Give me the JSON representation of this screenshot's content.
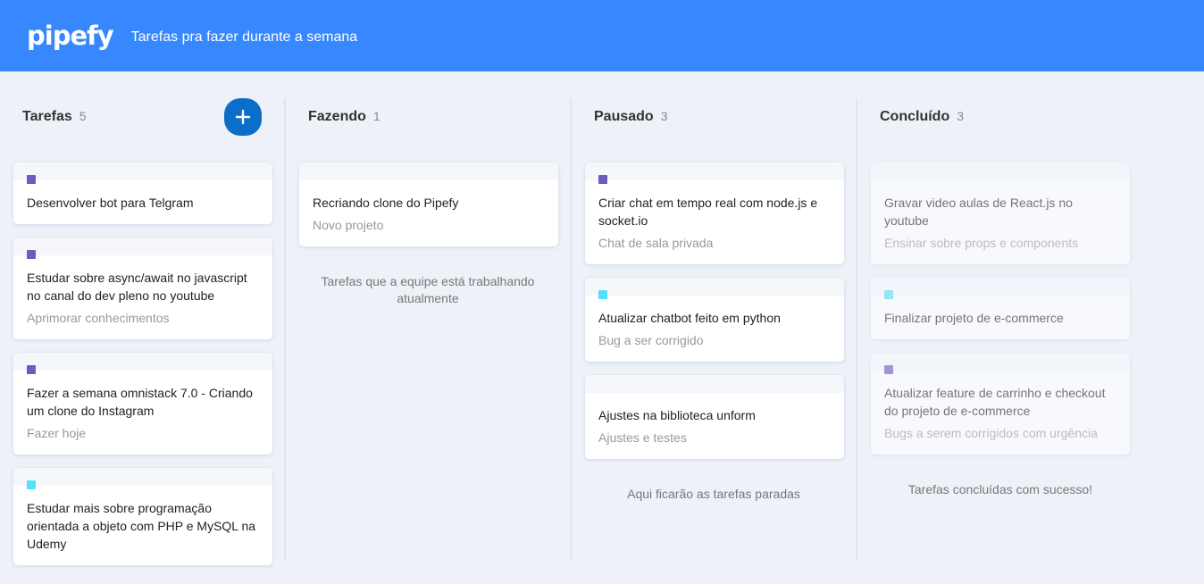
{
  "header": {
    "logo": "pipefy",
    "subtitle": "Tarefas pra fazer durante a semana"
  },
  "colors": {
    "header_bg": "#3788ff",
    "add_button": "#0b6fca",
    "label_purple": "#7159c1",
    "label_cyan": "#54e1f7"
  },
  "lists": [
    {
      "title": "Tarefas",
      "count": "5",
      "creatable": true,
      "cards": [
        {
          "title": "Desenvolver bot para Telgram",
          "subtitle": "",
          "label": "#7159c1"
        },
        {
          "title": "Estudar sobre async/await no javascript no canal do dev pleno no youtube",
          "subtitle": "Aprimorar conhecimentos",
          "label": "#7159c1"
        },
        {
          "title": "Fazer a semana omnistack 7.0 - Criando um clone do Instagram",
          "subtitle": "Fazer hoje",
          "label": "#7159c1"
        },
        {
          "title": "Estudar mais sobre programação orientada a objeto com PHP e MySQL na Udemy",
          "subtitle": "",
          "label": "#54e1f7"
        }
      ],
      "note": ""
    },
    {
      "title": "Fazendo",
      "count": "1",
      "creatable": false,
      "cards": [
        {
          "title": "Recriando clone do Pipefy",
          "subtitle": "Novo projeto",
          "label": ""
        }
      ],
      "note": "Tarefas que a equipe está trabalhando atualmente"
    },
    {
      "title": "Pausado",
      "count": "3",
      "creatable": false,
      "cards": [
        {
          "title": "Criar chat em tempo real com node.js e socket.io",
          "subtitle": "Chat de sala privada",
          "label": "#7159c1"
        },
        {
          "title": "Atualizar chatbot feito em python",
          "subtitle": "Bug a ser corrigido",
          "label": "#54e1f7"
        },
        {
          "title": "Ajustes na biblioteca unform",
          "subtitle": "Ajustes e testes",
          "label": ""
        }
      ],
      "note": "Aqui ficarão as tarefas paradas"
    },
    {
      "title": "Concluído",
      "count": "3",
      "creatable": false,
      "done": true,
      "cards": [
        {
          "title": "Gravar video aulas de React.js no youtube",
          "subtitle": "Ensinar sobre props e components",
          "label": ""
        },
        {
          "title": "Finalizar projeto de e-commerce",
          "subtitle": "",
          "label": "#54e1f7"
        },
        {
          "title": "Atualizar feature de carrinho e checkout do projeto de e-commerce",
          "subtitle": "Bugs a serem corrigidos com urgência",
          "label": "#7159c1"
        }
      ],
      "note": "Tarefas concluídas com sucesso!"
    }
  ]
}
